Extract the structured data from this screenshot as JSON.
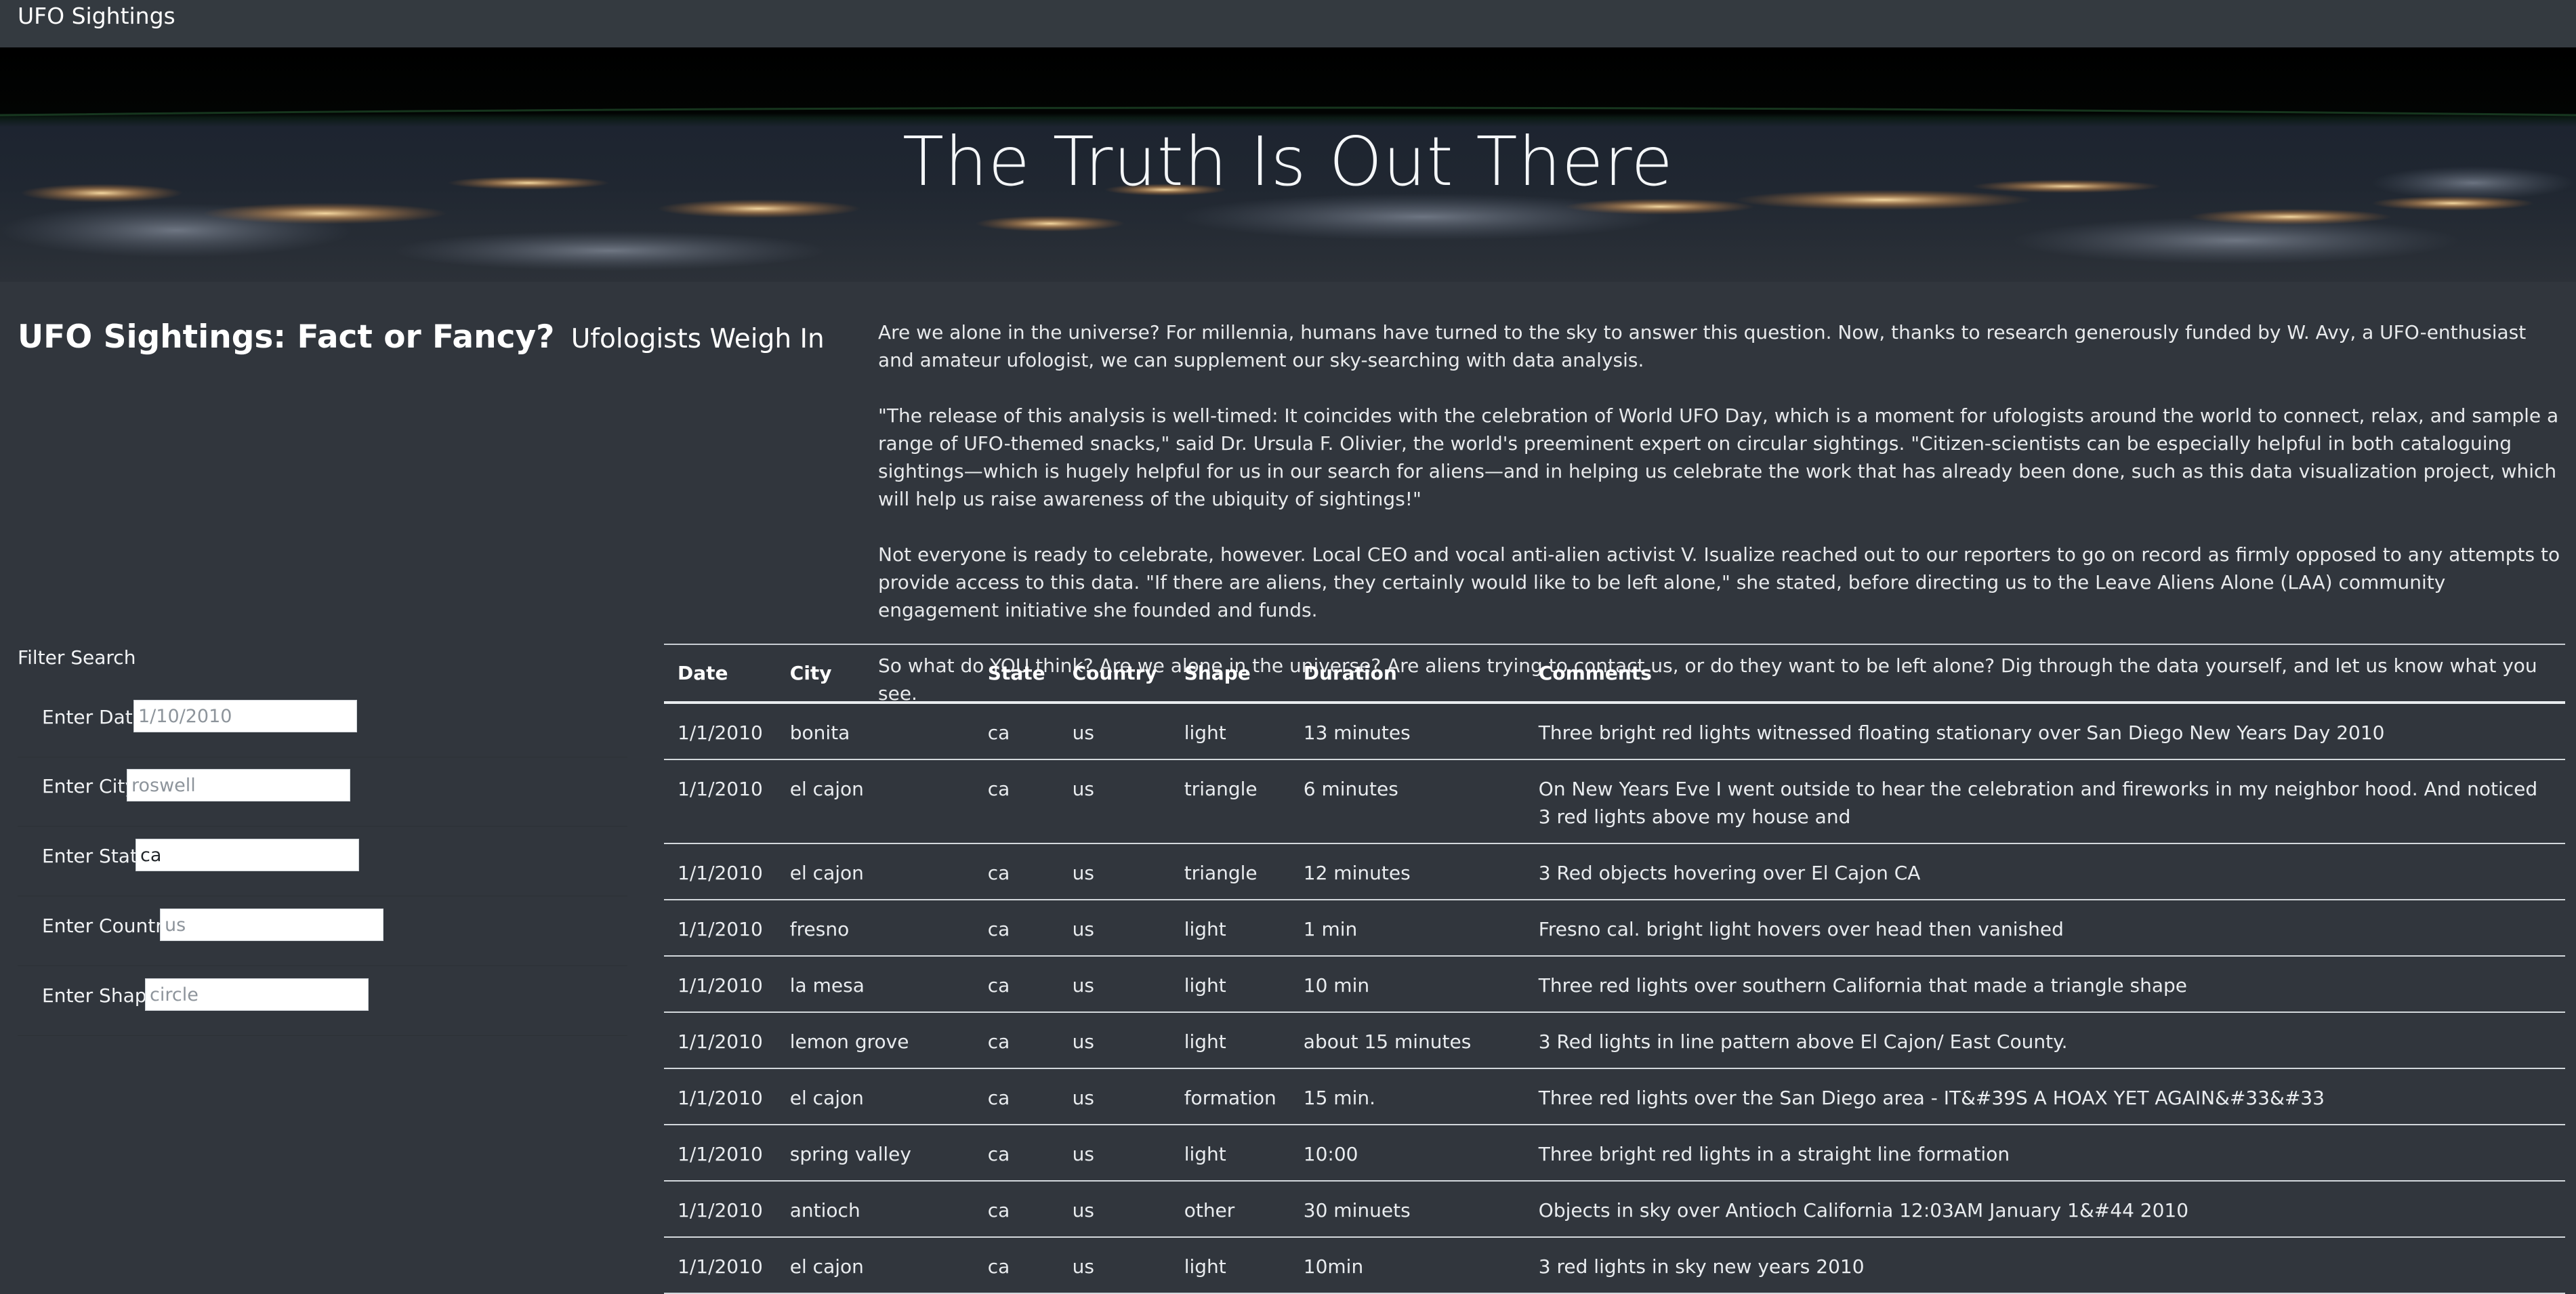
{
  "nav": {
    "brand": "UFO Sightings"
  },
  "hero": {
    "title": "The Truth Is Out There"
  },
  "article": {
    "heading": "UFO Sightings: Fact or Fancy?",
    "subheading": "Ufologists Weigh In",
    "paragraphs": [
      "Are we alone in the universe? For millennia, humans have turned to the sky to answer this question. Now, thanks to research generously funded by W. Avy, a UFO-enthusiast and amateur ufologist, we can supplement our sky-searching with data analysis.",
      "\"The release of this analysis is well-timed: It coincides with the celebration of World UFO Day, which is a moment for ufologists around the world to connect, relax, and sample a range of UFO-themed snacks,\" said Dr. Ursula F. Olivier, the world's preeminent expert on circular sightings. \"Citizen-scientists can be especially helpful in both cataloguing sightings—which is hugely helpful for us in our search for aliens—and in helping us celebrate the work that has already been done, such as this data visualization project, which will help us raise awareness of the ubiquity of sightings!\"",
      "Not everyone is ready to celebrate, however. Local CEO and vocal anti-alien activist V. Isualize reached out to our reporters to go on record as firmly opposed to any attempts to provide access to this data. \"If there are aliens, they certainly would like to be left alone,\" she stated, before directing us to the Leave Aliens Alone (LAA) community engagement initiative she founded and funds.",
      "So what do YOU think? Are we alone in the universe? Are aliens trying to contact us, or do they want to be left alone? Dig through the data yourself, and let us know what you see."
    ]
  },
  "filters": {
    "title": "Filter Search",
    "date": {
      "label": "Enter Date",
      "value": "",
      "placeholder": "1/10/2010"
    },
    "city": {
      "label": "Enter City",
      "value": "",
      "placeholder": "roswell"
    },
    "state": {
      "label": "Enter State",
      "value": "ca",
      "placeholder": ""
    },
    "country": {
      "label": "Enter Country",
      "value": "",
      "placeholder": "us"
    },
    "shape": {
      "label": "Enter Shape",
      "value": "",
      "placeholder": "circle"
    }
  },
  "table": {
    "headers": [
      "Date",
      "City",
      "State",
      "Country",
      "Shape",
      "Duration",
      "Comments"
    ],
    "rows": [
      [
        "1/1/2010",
        "bonita",
        "ca",
        "us",
        "light",
        "13 minutes",
        "Three bright red lights witnessed floating stationary over San Diego New Years Day 2010"
      ],
      [
        "1/1/2010",
        "el cajon",
        "ca",
        "us",
        "triangle",
        "6 minutes",
        "On New Years Eve I went outside to hear the celebration and fireworks in my neighbor hood. And noticed 3 red lights above my house and"
      ],
      [
        "1/1/2010",
        "el cajon",
        "ca",
        "us",
        "triangle",
        "12 minutes",
        "3 Red objects hovering over El Cajon CA"
      ],
      [
        "1/1/2010",
        "fresno",
        "ca",
        "us",
        "light",
        "1 min",
        "Fresno cal. bright light hovers over head then vanished"
      ],
      [
        "1/1/2010",
        "la mesa",
        "ca",
        "us",
        "light",
        "10 min",
        "Three red lights over southern California that made a triangle shape"
      ],
      [
        "1/1/2010",
        "lemon grove",
        "ca",
        "us",
        "light",
        "about 15 minutes",
        "3 Red lights in line pattern above El Cajon/ East County."
      ],
      [
        "1/1/2010",
        "el cajon",
        "ca",
        "us",
        "formation",
        "15 min.",
        "Three red lights over the San Diego area - IT&#39S A HOAX YET AGAIN&#33&#33"
      ],
      [
        "1/1/2010",
        "spring valley",
        "ca",
        "us",
        "light",
        "10:00",
        "Three bright red lights in a straight line formation"
      ],
      [
        "1/1/2010",
        "antioch",
        "ca",
        "us",
        "other",
        "30 minuets",
        "Objects in sky over Antioch California 12:03AM January 1&#44 2010"
      ],
      [
        "1/1/2010",
        "el cajon",
        "ca",
        "us",
        "light",
        "10min",
        "3 red lights in sky new years 2010"
      ]
    ]
  }
}
